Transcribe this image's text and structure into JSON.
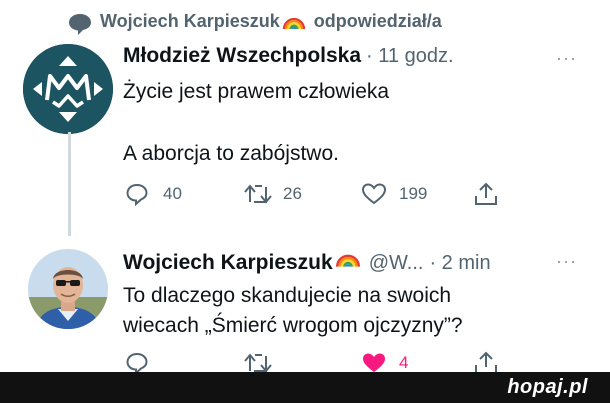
{
  "reply_header": {
    "user": "Wojciech Karpieszuk",
    "action": "odpowiedział/a"
  },
  "tweet1": {
    "author": "Młodzież Wszechpolska",
    "time": "· 11 godz.",
    "line1": "Życie jest prawem człowieka",
    "line2": "A aborcja to zabójstwo.",
    "replies": "40",
    "retweets": "26",
    "likes": "199",
    "avatar_text": "MW"
  },
  "tweet2": {
    "author": "Wojciech Karpieszuk",
    "handle": "@W...",
    "time": "· 2 min",
    "line1": "To dlaczego skandujecie na swoich",
    "line2": "wiecach „Śmierć wrogom ojczyzny”?",
    "likes": "4"
  },
  "more_icon": "···",
  "watermark": "hopaj.pl",
  "colors": {
    "muted": "#536471",
    "like_red": "#f91880",
    "avatar_teal": "#1d5462"
  }
}
